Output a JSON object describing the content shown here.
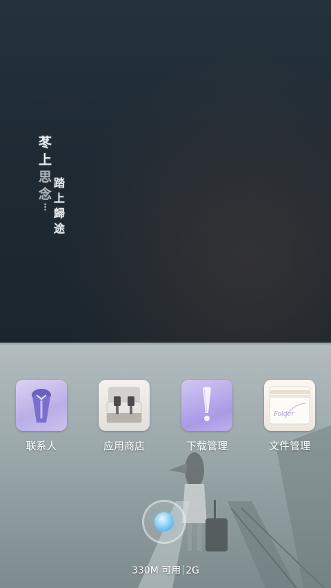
{
  "wallpaper": {
    "calligraphy": {
      "left_column": [
        "苳",
        "上",
        "思",
        "念"
      ],
      "right_column": [
        "踏",
        "上",
        "歸",
        "途"
      ],
      "dots": "⋮"
    }
  },
  "dock": {
    "apps": [
      {
        "label": "联系人",
        "icon": "contacts-icon"
      },
      {
        "label": "应用商店",
        "icon": "app-store-icon"
      },
      {
        "label": "下载管理",
        "icon": "download-manager-icon"
      },
      {
        "label": "文件管理",
        "icon": "file-manager-icon"
      }
    ],
    "memory": {
      "free_text": "330M 可用",
      "network": "2G"
    },
    "folder_script": "Folder"
  },
  "colors": {
    "wallpaper_dark": "#1f2a33",
    "dock_gray": "#9fa9ac",
    "icon_purple": "#a99ae6",
    "home_button_blue": "#3c9fdc"
  }
}
